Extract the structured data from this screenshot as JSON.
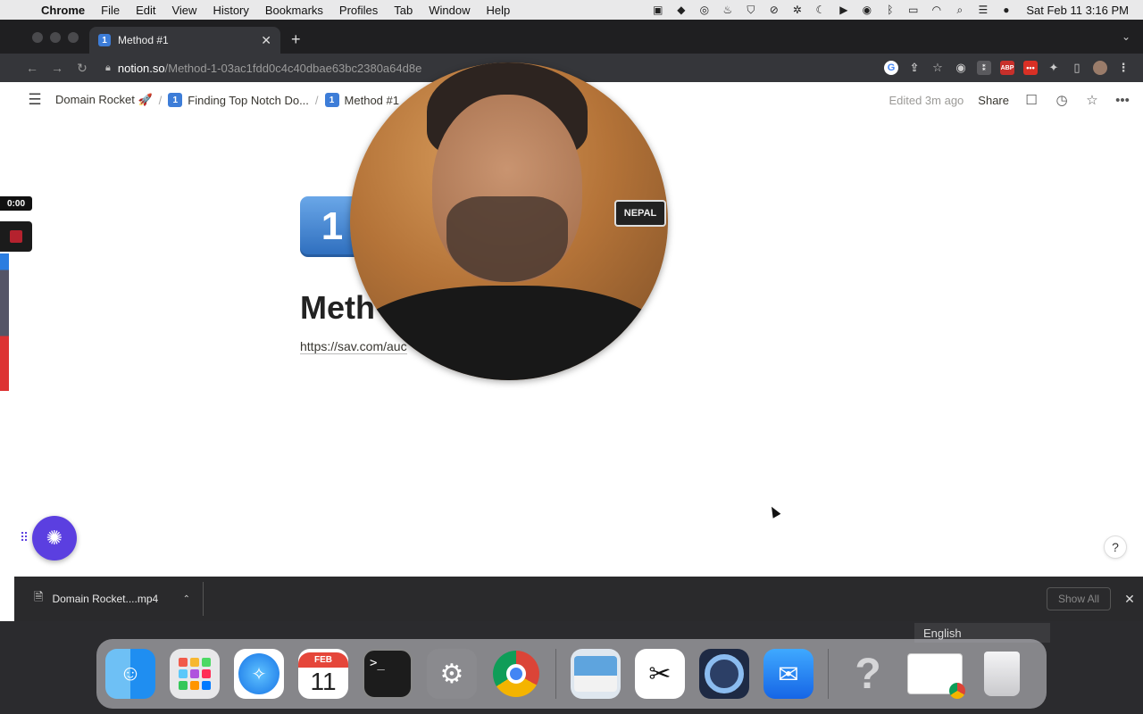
{
  "menubar": {
    "app": "Chrome",
    "items": [
      "File",
      "Edit",
      "View",
      "History",
      "Bookmarks",
      "Profiles",
      "Tab",
      "Window",
      "Help"
    ],
    "clock": "Sat Feb 11  3:16 PM"
  },
  "browser": {
    "tab_title": "Method #1",
    "tab_favicon": "1",
    "url_host": "notion.so",
    "url_path": "/Method-1-03ac1fdd0c4c40dbae63bc2380a64d8e",
    "extensions": [
      {
        "name": "google-extension-icon",
        "glyph": "G"
      },
      {
        "name": "share-page-icon",
        "glyph": "⇪"
      },
      {
        "name": "bookmark-star-icon",
        "glyph": "☆"
      },
      {
        "name": "camera-extension-icon",
        "glyph": "◉"
      },
      {
        "name": "gray-extension-icon",
        "glyph": "⁑"
      },
      {
        "name": "adblock-plus-icon",
        "glyph": "ABP"
      },
      {
        "name": "red-extension-icon",
        "glyph": "•••"
      },
      {
        "name": "extensions-puzzle-icon",
        "glyph": "✦"
      },
      {
        "name": "sidebar-toggle-icon",
        "glyph": "▯"
      },
      {
        "name": "profile-avatar-icon",
        "glyph": ""
      },
      {
        "name": "browser-menu-icon",
        "glyph": "⋮"
      }
    ]
  },
  "notion": {
    "breadcrumbs": [
      {
        "label": "Domain Rocket 🚀",
        "icon": ""
      },
      {
        "label": "Finding Top Notch Do...",
        "icon": "1"
      },
      {
        "label": "Method #1",
        "icon": "1"
      }
    ],
    "edited": "Edited 3m ago",
    "share": "Share",
    "page_icon": "1",
    "page_title": "Meth",
    "page_link": "https://sav.com/auc",
    "help": "?"
  },
  "recording": {
    "time": "0:00"
  },
  "downloads": {
    "file_name": "Domain Rocket....mp4",
    "show_all": "Show All"
  },
  "webcam": {
    "plate_text": "NEPAL"
  },
  "backdrop": {
    "language": "English"
  },
  "dock": {
    "calendar_month": "FEB",
    "calendar_day": "11",
    "terminal_prompt": ">_"
  }
}
